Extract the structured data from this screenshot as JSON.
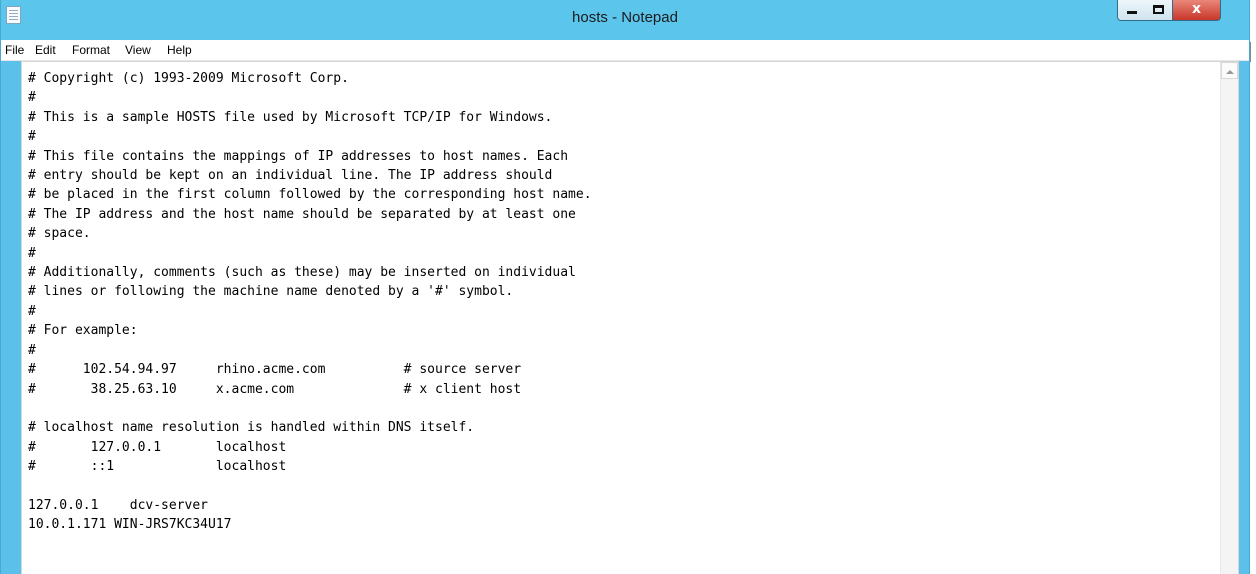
{
  "window": {
    "title": "hosts - Notepad",
    "close_glyph": "x",
    "titlebar_color": "#5cc5ec",
    "close_color": "#c8372a",
    "icons": {
      "app": "notepad-icon",
      "minimize": "minimize-icon",
      "maximize": "maximize-icon",
      "close": "close-icon"
    }
  },
  "menu": {
    "items": [
      "File",
      "Edit",
      "Format",
      "View",
      "Help"
    ]
  },
  "editor": {
    "content": "# Copyright (c) 1993-2009 Microsoft Corp.\n#\n# This is a sample HOSTS file used by Microsoft TCP/IP for Windows.\n#\n# This file contains the mappings of IP addresses to host names. Each\n# entry should be kept on an individual line. The IP address should\n# be placed in the first column followed by the corresponding host name.\n# The IP address and the host name should be separated by at least one\n# space.\n#\n# Additionally, comments (such as these) may be inserted on individual\n# lines or following the machine name denoted by a '#' symbol.\n#\n# For example:\n#\n#      102.54.94.97     rhino.acme.com          # source server\n#       38.25.63.10     x.acme.com              # x client host\n\n# localhost name resolution is handled within DNS itself.\n#\t127.0.0.1       localhost\n#\t::1             localhost\n\n127.0.0.1    dcv-server\n10.0.1.171 WIN-JRS7KC34U17",
    "scrollbar_up_icon": "scroll-up-arrow-icon"
  }
}
